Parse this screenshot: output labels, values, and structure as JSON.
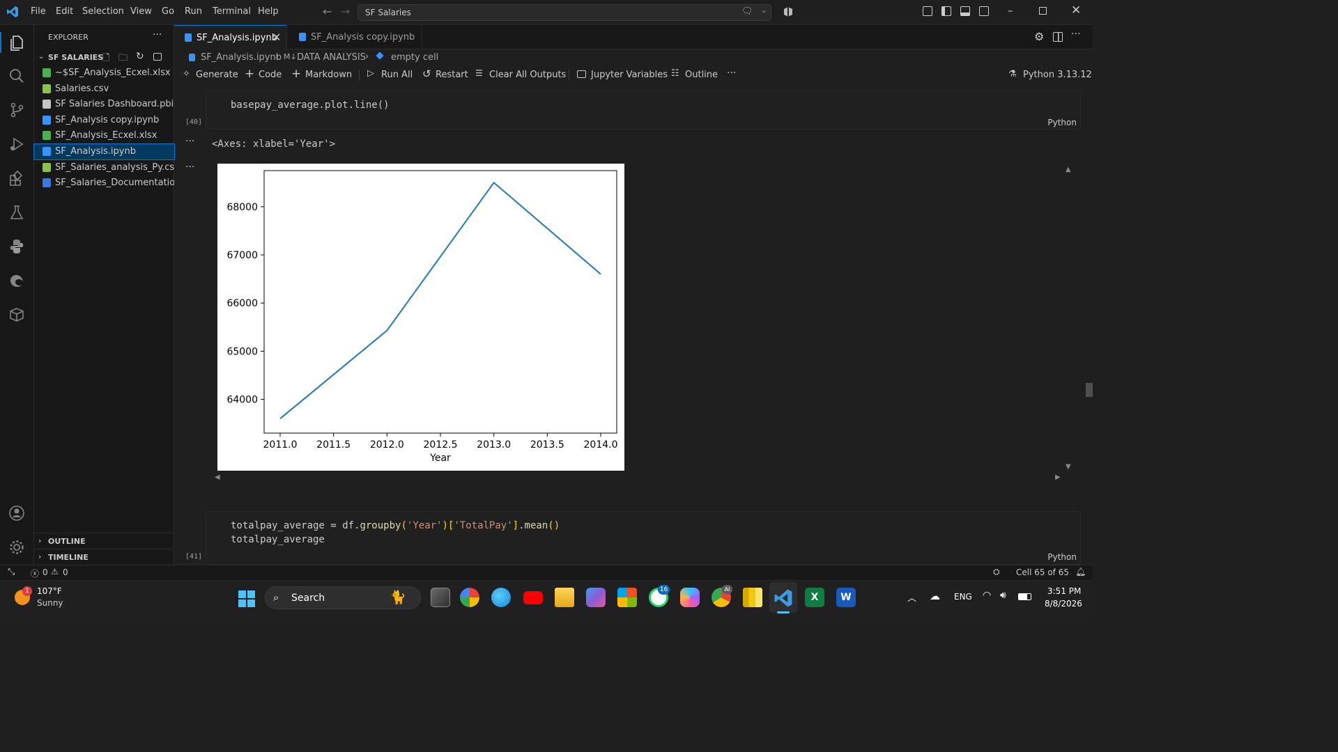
{
  "menu": [
    "File",
    "Edit",
    "Selection",
    "View",
    "Go",
    "Run",
    "Terminal",
    "Help"
  ],
  "search": {
    "value": "SF Salaries"
  },
  "explorer": {
    "title": "EXPLORER",
    "folder": "SF SALARIES",
    "files": [
      {
        "name": "~$SF_Analysis_Ecxel.xlsx",
        "icon": "excel-icon",
        "color": "#4caf50"
      },
      {
        "name": "Salaries.csv",
        "icon": "csv-icon",
        "color": "#8bc34a"
      },
      {
        "name": "SF Salaries Dashboard.pbix",
        "icon": "file-icon",
        "color": "#c5c5c5"
      },
      {
        "name": "SF_Analysis copy.ipynb",
        "icon": "notebook-icon",
        "color": "#3794ff"
      },
      {
        "name": "SF_Analysis_Ecxel.xlsx",
        "icon": "excel-icon",
        "color": "#4caf50"
      },
      {
        "name": "SF_Analysis.ipynb",
        "icon": "notebook-icon",
        "color": "#3794ff"
      },
      {
        "name": "SF_Salaries_analysis_Py.csv",
        "icon": "csv-icon",
        "color": "#8bc34a"
      },
      {
        "name": "SF_Salaries_Documentation...",
        "icon": "word-icon",
        "color": "#3b78d8"
      }
    ],
    "outline": "OUTLINE",
    "timeline": "TIMELINE"
  },
  "tabs": [
    {
      "label": "SF_Analysis.ipynb"
    },
    {
      "label": "SF_Analysis copy.ipynb"
    }
  ],
  "breadcrumb": {
    "file": "SF_Analysis.ipynb",
    "section": "DATA ANALYSIS",
    "cell": "empty cell"
  },
  "toolbar": {
    "generate": "Generate",
    "code": "Code",
    "markdown": "Markdown",
    "run_all": "Run All",
    "restart": "Restart",
    "clear": "Clear All Outputs",
    "variables": "Jupyter Variables",
    "outline": "Outline",
    "kernel": "Python 3.13.12"
  },
  "cell40": {
    "exec": "[40]",
    "code": "basepay_average.plot.line()",
    "lang": "Python",
    "output_text": "<Axes: xlabel='Year'>"
  },
  "cell41": {
    "exec": "[41]",
    "line1": "totalpay_average = df.groupby('Year')['TotalPay'].mean()",
    "line2": "totalpay_average",
    "lang": "Python"
  },
  "chart_data": {
    "type": "line",
    "xlabel": "Year",
    "ylabel": "",
    "x": [
      2011,
      2012,
      2013,
      2014
    ],
    "series": [
      {
        "values": [
          63600,
          65430,
          68500,
          66600
        ],
        "color": "#1f77b4"
      }
    ],
    "xticks": [
      "2011.0",
      "2011.5",
      "2012.0",
      "2012.5",
      "2013.0",
      "2013.5",
      "2014.0"
    ],
    "yticks": [
      "64000",
      "65000",
      "66000",
      "67000",
      "68000"
    ],
    "xlim": [
      2010.85,
      2014.15
    ],
    "ylim": [
      63300,
      68750
    ]
  },
  "status": {
    "errors": "0",
    "warnings": "0",
    "cell": "Cell 65 of 65"
  },
  "taskbar": {
    "temp": "107°F",
    "weather": "Sunny",
    "search": "Search",
    "lang": "ENG",
    "time": "3:51 PM",
    "date": "8/8/2026",
    "badge_weather": "1",
    "badge_whatsapp": "16",
    "badge_ai": "AI"
  }
}
